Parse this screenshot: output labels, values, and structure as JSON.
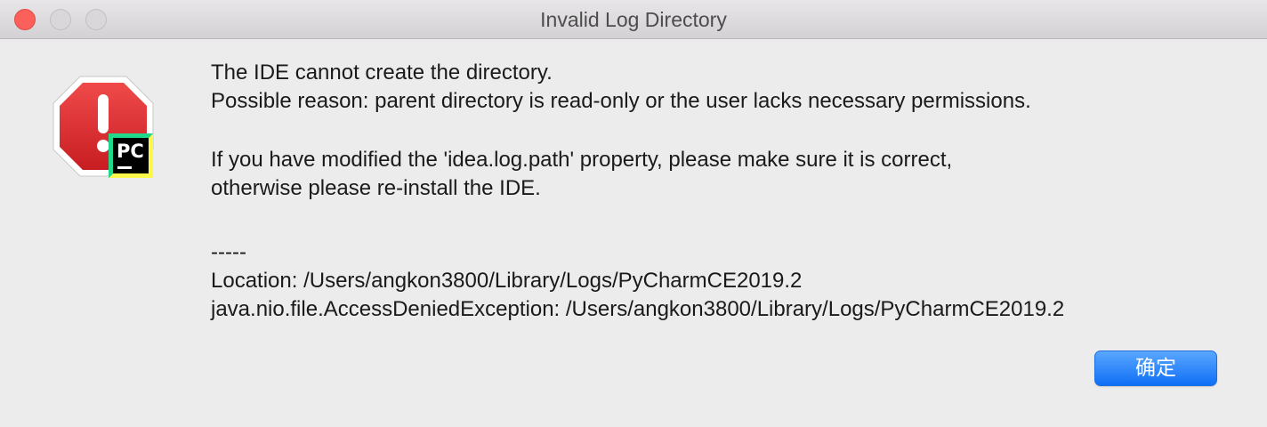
{
  "window": {
    "title": "Invalid Log Directory"
  },
  "icon": {
    "name": "stop-sign-warning-icon",
    "badge_text": "PC",
    "colors": {
      "stop_sign": "#d7262b",
      "badge_background": "#000000",
      "badge_accent_green": "#21d789",
      "badge_accent_yellow": "#fcf84a"
    }
  },
  "message": {
    "line1": "The IDE cannot create the directory.",
    "line2": "Possible reason: parent directory is read-only or the user lacks necessary permissions.",
    "line3": "If you have modified the 'idea.log.path' property, please make sure it is correct,",
    "line4": "otherwise please re-install the IDE.",
    "separator": "-----",
    "location": "Location: /Users/angkon3800/Library/Logs/PyCharmCE2019.2",
    "exception": "java.nio.file.AccessDeniedException: /Users/angkon3800/Library/Logs/PyCharmCE2019.2"
  },
  "buttons": {
    "ok_label": "确定"
  },
  "colors": {
    "button_accent": "#1a7cf5",
    "close_traffic_light": "#fc605b"
  }
}
